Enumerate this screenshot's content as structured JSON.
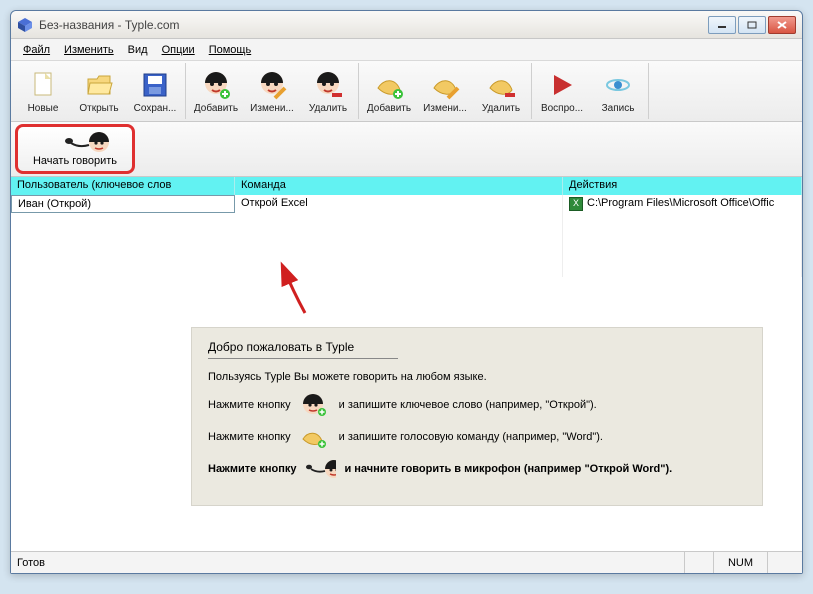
{
  "titlebar": {
    "title": "Без-названия - Typle.com"
  },
  "menu": {
    "file": "Файл",
    "edit": "Изменить",
    "view": "Вид",
    "options": "Опции",
    "help": "Помощь"
  },
  "toolbar": {
    "new": "Новые",
    "open": "Открыть",
    "save": "Сохран...",
    "add_user": "Добавить",
    "edit_user": "Измени...",
    "del_user": "Удалить",
    "add_cmd": "Добавить",
    "edit_cmd": "Измени...",
    "del_cmd": "Удалить",
    "play": "Воспро...",
    "record": "Запись",
    "speak": "Начать говорить"
  },
  "headers": {
    "user": "Пользователь (ключевое слов",
    "command": "Команда",
    "actions": "Действия"
  },
  "row": {
    "user": "Иван (Открой)",
    "command": "Открой Excel",
    "action": "C:\\Program Files\\Microsoft Office\\Offic"
  },
  "welcome": {
    "title": "Добро пожаловать в Typle",
    "intro": "Пользуясь Typle Вы можете говорить на любом языке.",
    "press": "Нажмите кнопку",
    "press_bold": "Нажмите кнопку",
    "line1": "и запишите ключевое слово (например, \"Открой\").",
    "line2": "и запишите голосовую команду (например, \"Word\").",
    "line3": "и начните говорить в микрофон (например \"Открой Word\")."
  },
  "status": {
    "ready": "Готов",
    "num": "NUM"
  }
}
